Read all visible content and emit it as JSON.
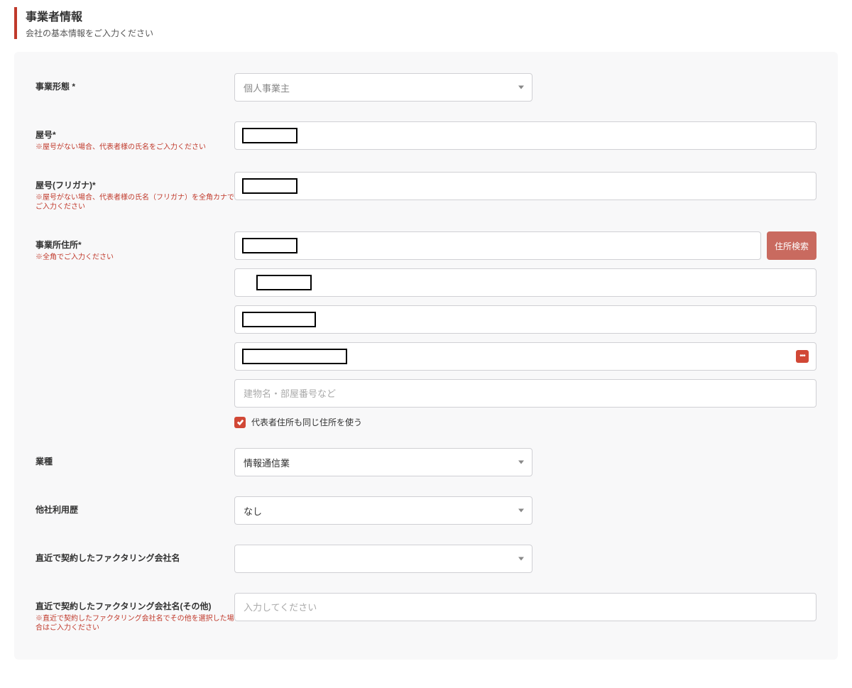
{
  "header": {
    "title": "事業者情報",
    "subtitle": "会社の基本情報をご入力ください"
  },
  "labels": {
    "business_form": "事業形態 *",
    "trade_name": "屋号*",
    "trade_name_note": "※屋号がない場合、代表者様の氏名をご入力ください",
    "trade_name_kana": "屋号(フリガナ)*",
    "trade_name_kana_note": "※屋号がない場合、代表者様の氏名（フリガナ）を全角カナでご入力ください",
    "office_address": "事業所住所*",
    "office_address_note": "※全角でご入力ください",
    "building_placeholder": "建物名・部屋番号など",
    "same_address_label": "代表者住所も同じ住所を使う",
    "industry": "業種",
    "other_usage": "他社利用歴",
    "recent_factoring": "直近で契約したファクタリング会社名",
    "recent_factoring_other": "直近で契約したファクタリング会社名(その他)",
    "recent_factoring_other_note": "※直近で契約したファクタリング会社名でその他を選択した場合はご入力ください",
    "recent_factoring_other_placeholder": "入力してください"
  },
  "values": {
    "business_form": "個人事業主",
    "industry": "情報通信業",
    "other_usage": "なし",
    "recent_factoring": "",
    "address_search_btn": "住所検索",
    "same_address_checked": true
  }
}
